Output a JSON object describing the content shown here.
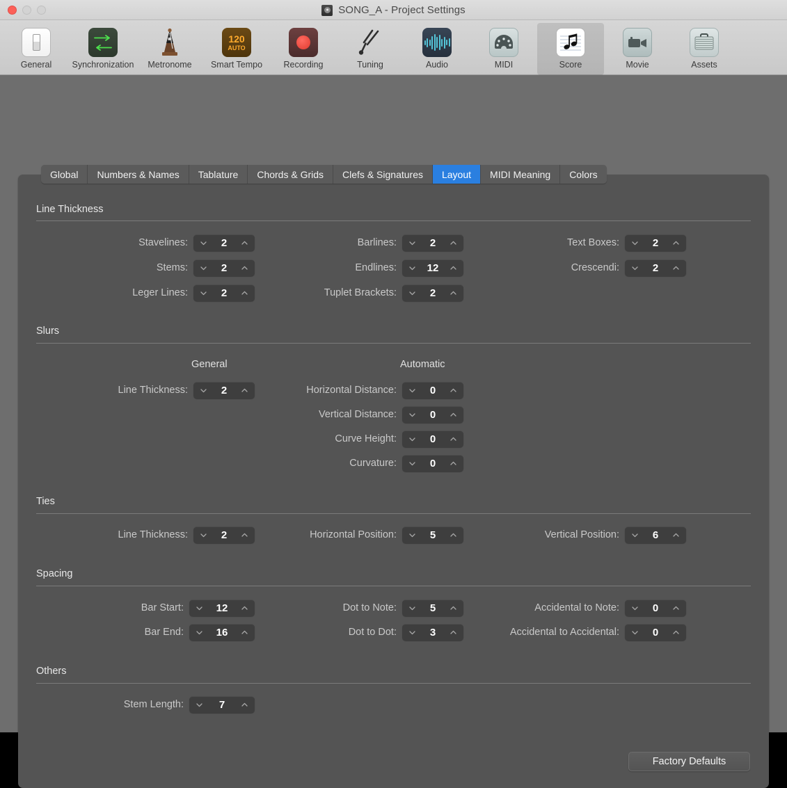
{
  "window": {
    "title": "SONG_A - Project Settings",
    "doc_icon": "project-disc-icon"
  },
  "toolbar": {
    "items": [
      {
        "label": "General",
        "icon": "general-switch-icon",
        "selected": false
      },
      {
        "label": "Synchronization",
        "icon": "synchronization-arrows-icon",
        "selected": false
      },
      {
        "label": "Metronome",
        "icon": "metronome-icon",
        "selected": false
      },
      {
        "label": "Smart Tempo",
        "icon": "smart-tempo-icon",
        "selected": false
      },
      {
        "label": "Recording",
        "icon": "record-dot-icon",
        "selected": false
      },
      {
        "label": "Tuning",
        "icon": "tuning-fork-icon",
        "selected": false
      },
      {
        "label": "Audio",
        "icon": "audio-waveform-icon",
        "selected": false
      },
      {
        "label": "MIDI",
        "icon": "midi-port-icon",
        "selected": false
      },
      {
        "label": "Score",
        "icon": "score-note-icon",
        "selected": true
      },
      {
        "label": "Movie",
        "icon": "movie-camera-icon",
        "selected": false
      },
      {
        "label": "Assets",
        "icon": "assets-case-icon",
        "selected": false
      }
    ],
    "smart_tempo": {
      "bpm": "120",
      "mode": "AUTO"
    }
  },
  "tabs": [
    {
      "label": "Global",
      "active": false
    },
    {
      "label": "Numbers & Names",
      "active": false
    },
    {
      "label": "Tablature",
      "active": false
    },
    {
      "label": "Chords & Grids",
      "active": false
    },
    {
      "label": "Clefs & Signatures",
      "active": false
    },
    {
      "label": "Layout",
      "active": true
    },
    {
      "label": "MIDI Meaning",
      "active": false
    },
    {
      "label": "Colors",
      "active": false
    }
  ],
  "sections": {
    "line_thickness": {
      "title": "Line Thickness",
      "fields": {
        "stavelines": {
          "label": "Stavelines:",
          "value": "2"
        },
        "stems": {
          "label": "Stems:",
          "value": "2"
        },
        "leger_lines": {
          "label": "Leger Lines:",
          "value": "2"
        },
        "barlines": {
          "label": "Barlines:",
          "value": "2"
        },
        "endlines": {
          "label": "Endlines:",
          "value": "12"
        },
        "tuplet_brackets": {
          "label": "Tuplet Brackets:",
          "value": "2"
        },
        "text_boxes": {
          "label": "Text Boxes:",
          "value": "2"
        },
        "crescendi": {
          "label": "Crescendi:",
          "value": "2"
        }
      }
    },
    "slurs": {
      "title": "Slurs",
      "column_general": "General",
      "column_automatic": "Automatic",
      "fields": {
        "line_thickness": {
          "label": "Line Thickness:",
          "value": "2"
        },
        "horizontal_distance": {
          "label": "Horizontal Distance:",
          "value": "0"
        },
        "vertical_distance": {
          "label": "Vertical Distance:",
          "value": "0"
        },
        "curve_height": {
          "label": "Curve Height:",
          "value": "0"
        },
        "curvature": {
          "label": "Curvature:",
          "value": "0"
        }
      }
    },
    "ties": {
      "title": "Ties",
      "fields": {
        "line_thickness": {
          "label": "Line Thickness:",
          "value": "2"
        },
        "horizontal_position": {
          "label": "Horizontal Position:",
          "value": "5"
        },
        "vertical_position": {
          "label": "Vertical Position:",
          "value": "6"
        }
      }
    },
    "spacing": {
      "title": "Spacing",
      "fields": {
        "bar_start": {
          "label": "Bar Start:",
          "value": "12"
        },
        "bar_end": {
          "label": "Bar End:",
          "value": "16"
        },
        "dot_to_note": {
          "label": "Dot to Note:",
          "value": "5"
        },
        "dot_to_dot": {
          "label": "Dot to Dot:",
          "value": "3"
        },
        "accidental_to_note": {
          "label": "Accidental to Note:",
          "value": "0"
        },
        "accidental_to_accidental": {
          "label": "Accidental to Accidental:",
          "value": "0"
        }
      }
    },
    "others": {
      "title": "Others",
      "fields": {
        "stem_length": {
          "label": "Stem Length:",
          "value": "7"
        }
      }
    }
  },
  "buttons": {
    "factory_defaults": "Factory Defaults"
  },
  "colors": {
    "accent_tab_active": "#2a7fe0",
    "panel_bg": "#545454",
    "window_bg": "#6e6e6e",
    "titlebar_bg": "#d6d6d6",
    "close_button": "#fc6058"
  }
}
